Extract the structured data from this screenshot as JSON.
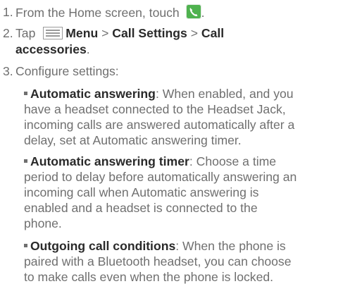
{
  "steps": [
    {
      "num": "1.",
      "text": "From the Home screen, touch",
      "icon": "phone-icon",
      "after": "."
    },
    {
      "num": "2.",
      "pre": "Tap",
      "icon": "menu-icon",
      "menu": "Menu",
      "sep1": ">",
      "call_settings": "Call Settings",
      "sep2": ">",
      "call_acc_1": "Call",
      "call_acc_2": "accessories",
      "after": "."
    },
    {
      "num": "3.",
      "text": "Configure settings:"
    }
  ],
  "bullets": [
    {
      "term": "Automatic answering",
      "lines": [
        ": When enabled, and you",
        "have a headset connected to the Headset Jack,",
        "incoming calls are answered automatically after a",
        "delay, set at Automatic answering timer."
      ]
    },
    {
      "term": "Automatic answering timer",
      "lines": [
        ": Choose a time",
        "period to delay before automatically answering an",
        "incoming call when Automatic answering is",
        "enabled and a headset is connected to the",
        "phone."
      ]
    },
    {
      "term": "Outgoing call conditions",
      "lines": [
        ": When the phone is",
        "paired with a Bluetooth headset, you can choose",
        "to make calls even when the phone is locked."
      ]
    }
  ],
  "colors": {
    "text": "#2a2a2a",
    "muted": "#6f6f6f",
    "phone_icon": "#3aa63a"
  }
}
